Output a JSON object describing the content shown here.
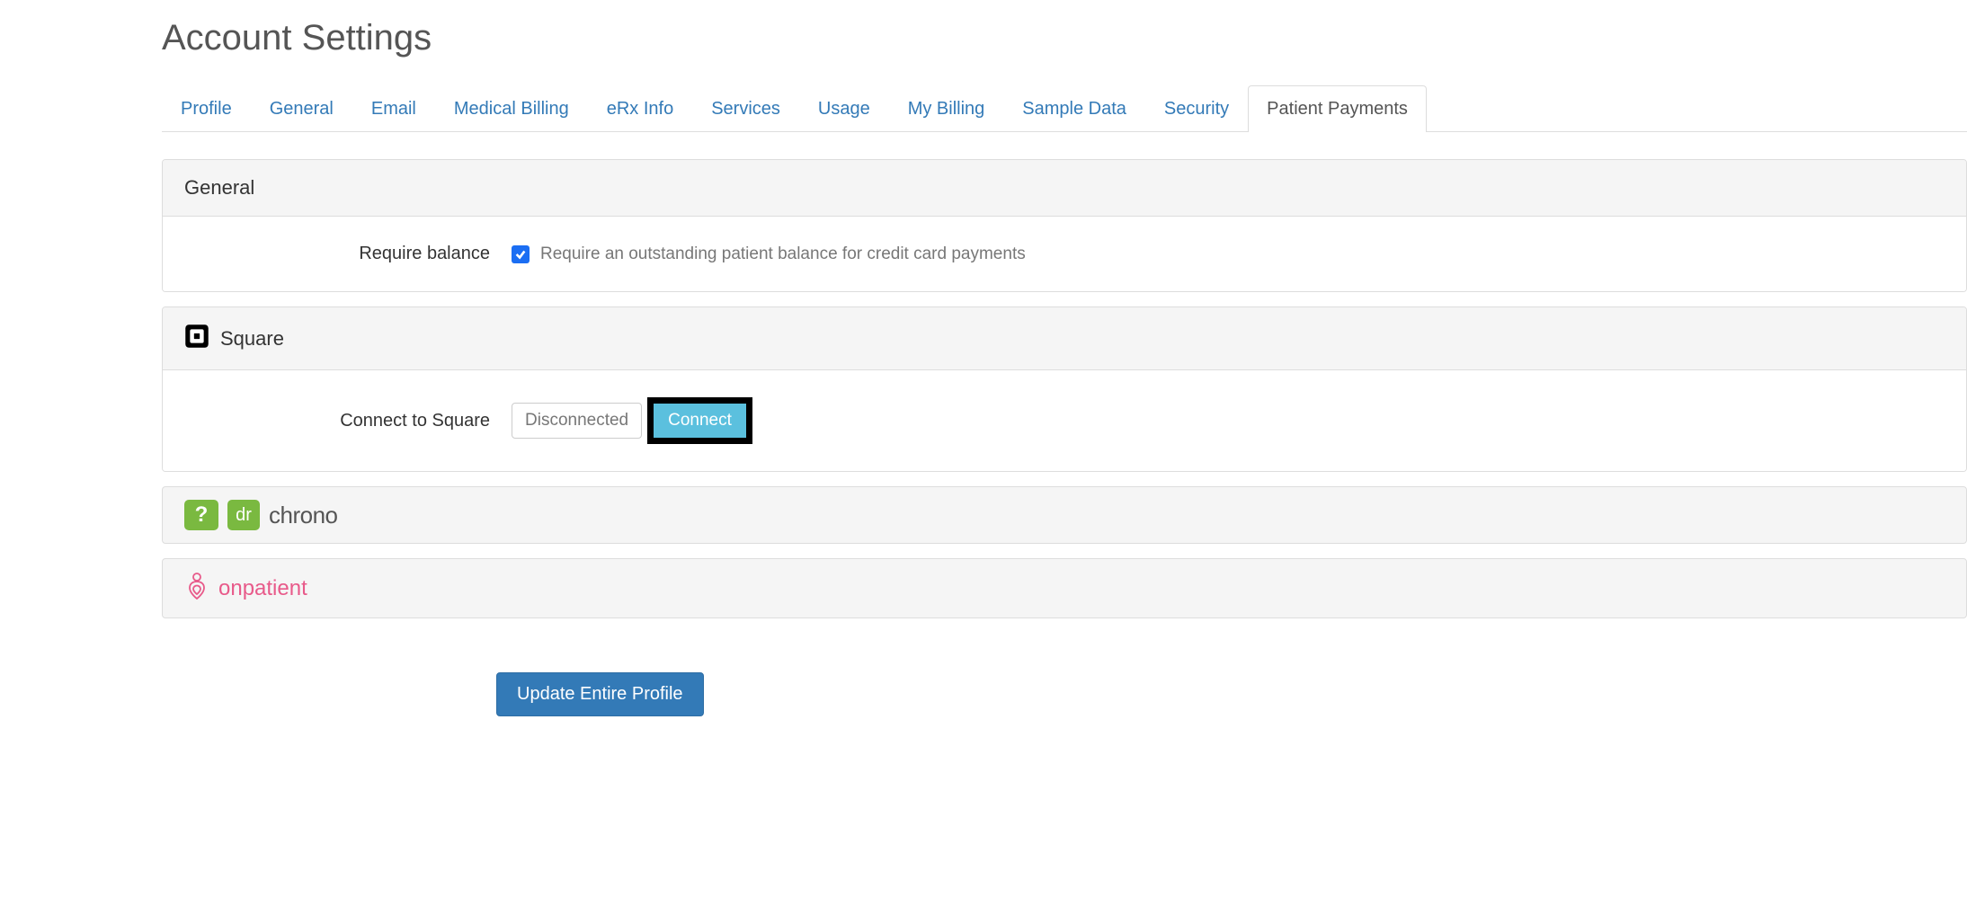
{
  "page_title": "Account Settings",
  "tabs": [
    {
      "label": "Profile",
      "active": false
    },
    {
      "label": "General",
      "active": false
    },
    {
      "label": "Email",
      "active": false
    },
    {
      "label": "Medical Billing",
      "active": false
    },
    {
      "label": "eRx Info",
      "active": false
    },
    {
      "label": "Services",
      "active": false
    },
    {
      "label": "Usage",
      "active": false
    },
    {
      "label": "My Billing",
      "active": false
    },
    {
      "label": "Sample Data",
      "active": false
    },
    {
      "label": "Security",
      "active": false
    },
    {
      "label": "Patient Payments",
      "active": true
    }
  ],
  "general_section": {
    "title": "General",
    "require_balance_label": "Require balance",
    "require_balance_checked": true,
    "require_balance_help": "Require an outstanding patient balance for credit card payments"
  },
  "square_section": {
    "title": "Square",
    "connect_label": "Connect to Square",
    "status": "Disconnected",
    "connect_button": "Connect"
  },
  "drchrono_section": {
    "question_mark": "?",
    "dr_text": "dr",
    "chrono_text": "chrono"
  },
  "onpatient_section": {
    "text": "onpatient"
  },
  "update_button": "Update Entire Profile"
}
